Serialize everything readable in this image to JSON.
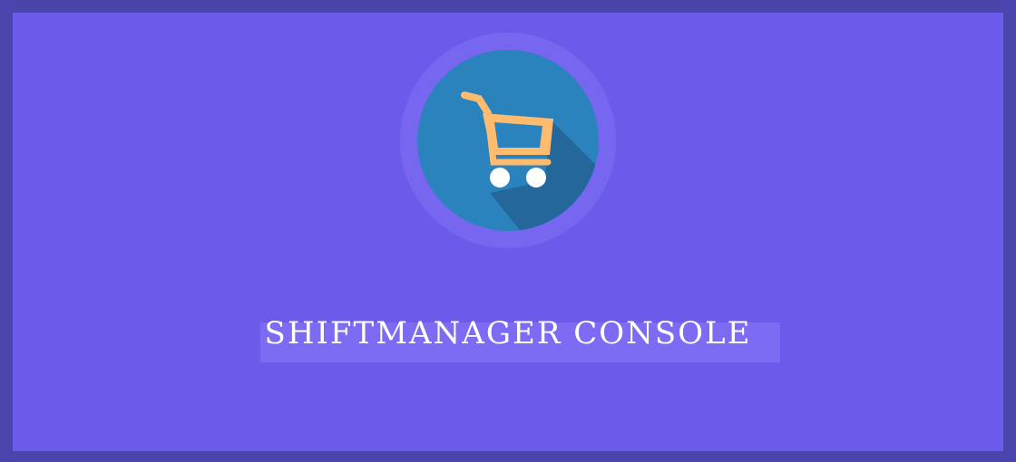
{
  "app": {
    "title": "SHIFTMANAGER CONSOLE"
  },
  "logo": {
    "icon": "shopping-cart-icon",
    "circle_color": "#2b83bd",
    "ring_color": "#7766f0",
    "cart_color": "#ffbb6e",
    "wheel_color": "#ffffff",
    "shadow_color": "#23679b"
  },
  "colors": {
    "background": "#6c5bea",
    "border": "#4a45ad",
    "title_highlight": "#7c6cf3",
    "title_text": "#ffffff"
  }
}
